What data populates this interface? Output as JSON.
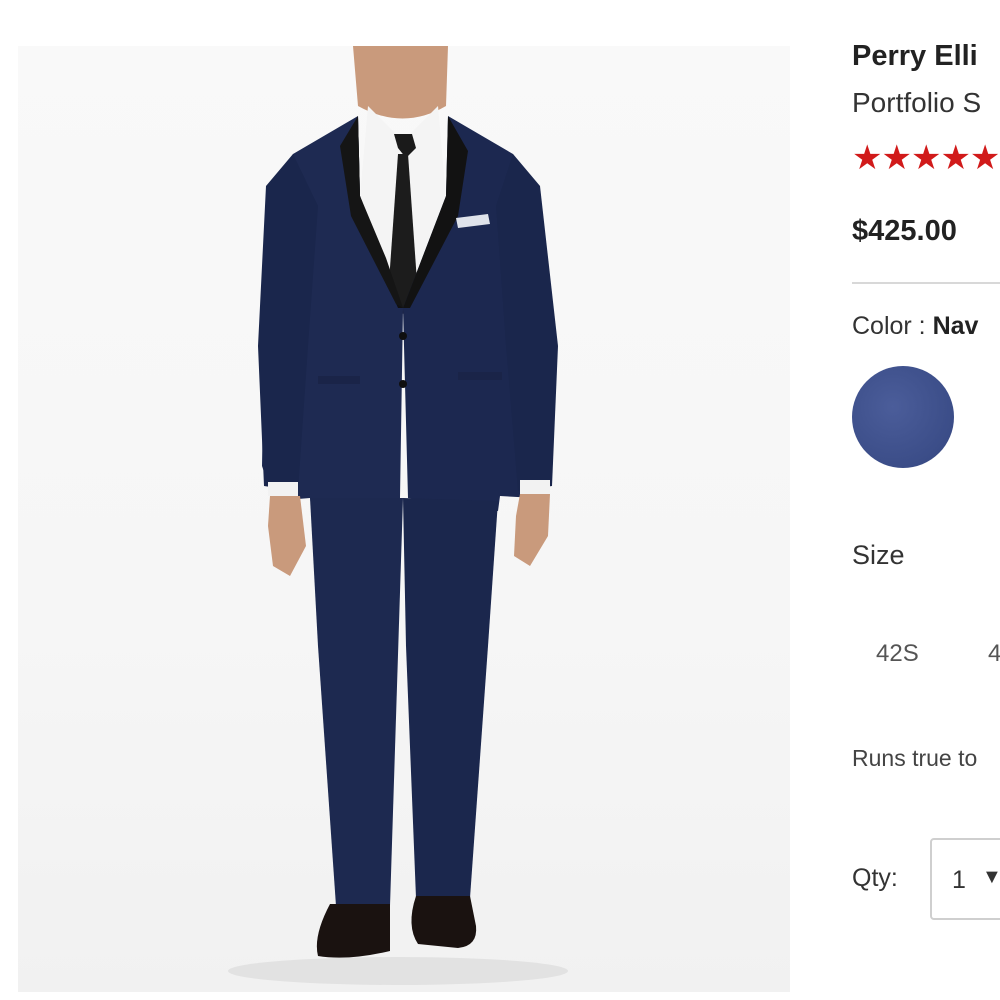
{
  "product": {
    "brand": "Perry Elli",
    "name": "Portfolio S",
    "rating_stars": "★★★★★",
    "rating_color": "#d11a1a",
    "price": "$425.00"
  },
  "color": {
    "label": "Color :",
    "selected": "Nav",
    "swatch_color": "#3d4f8a"
  },
  "size": {
    "label": "Size",
    "options": [
      "42S",
      "4"
    ],
    "fit_note": "Runs true to"
  },
  "quantity": {
    "label": "Qty:",
    "value": "1",
    "caret_icon": "chevron-down-icon"
  }
}
